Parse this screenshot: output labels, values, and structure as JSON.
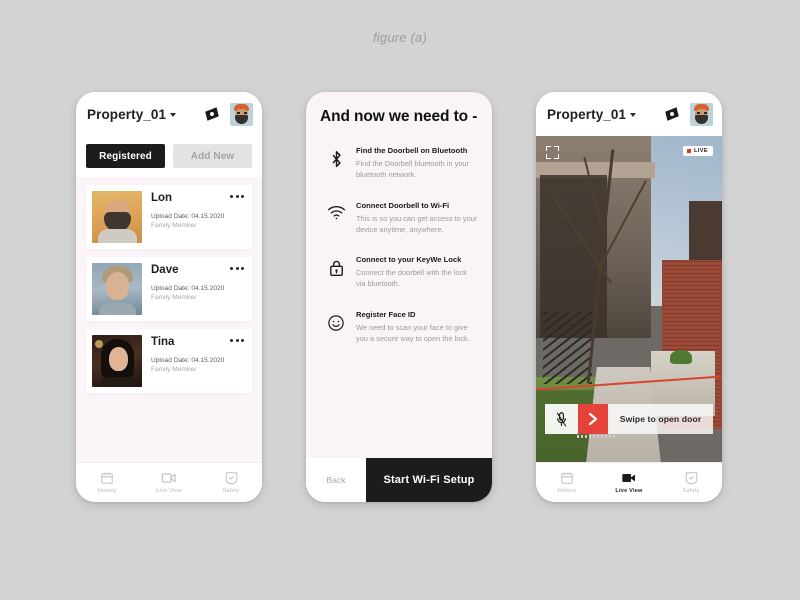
{
  "figure": {
    "caption": "figure (a)"
  },
  "colors": {
    "page_background": "#d3d3d3",
    "screen_background": "#fbf5f9",
    "accent_black": "#1c1c1c",
    "accent_red": "#e5423a",
    "live_dot": "#e0352a",
    "muted_text": "#a8a8a8"
  },
  "screen_registered": {
    "header": {
      "title": "Property_01",
      "dropdown_icon": "chevron-down-icon",
      "sparkle_icon": "sparkle-icon",
      "avatar_icon": "user-avatar"
    },
    "segments": [
      {
        "label": "Registered",
        "active": true
      },
      {
        "label": "Add New",
        "active": false
      }
    ],
    "people": [
      {
        "name": "Lon",
        "upload": "Upload Date: 04.15.2020",
        "role": "Family Member",
        "menu_icon": "more-options-icon"
      },
      {
        "name": "Dave",
        "upload": "Upload Date: 04.15.2020",
        "role": "Family Member",
        "menu_icon": "more-options-icon"
      },
      {
        "name": "Tina",
        "upload": "Upload Date: 04.15.2020",
        "role": "Family Member",
        "menu_icon": "more-options-icon"
      }
    ],
    "tabs": [
      {
        "label": "History",
        "icon": "calendar-icon",
        "active": false
      },
      {
        "label": "Live View",
        "icon": "video-camera-icon",
        "active": false
      },
      {
        "label": "Safety",
        "icon": "shield-check-icon",
        "active": false
      }
    ]
  },
  "screen_setup": {
    "title": "And now we need to -",
    "items": [
      {
        "icon": "bluetooth-icon",
        "title": "Find the Doorbell on Bluetooth",
        "desc": "Find the Doorbell bluetooth in your bluetooth network."
      },
      {
        "icon": "wifi-icon",
        "title": "Connect Doorbell to Wi-Fi",
        "desc": "This is so you can get access to your device anytime, anywhere."
      },
      {
        "icon": "lock-icon",
        "title": "Connect to your KeyWe Lock",
        "desc": "Connect the doorbell with the lock via bluetooth."
      },
      {
        "icon": "smiley-face-icon",
        "title": "Register Face ID",
        "desc": "We need to scan your face to give you a secure way to open the lock."
      }
    ],
    "back_label": "Back",
    "primary_label": "Start Wi-Fi Setup"
  },
  "screen_live": {
    "header": {
      "title": "Property_01",
      "dropdown_icon": "chevron-down-icon",
      "sparkle_icon": "sparkle-icon",
      "avatar_icon": "user-avatar"
    },
    "video": {
      "expand_icon": "fullscreen-expand-icon",
      "live_badge": "LIVE",
      "mic_icon": "microphone-muted-icon",
      "swipe_label": "Swipe to open door",
      "swipe_handle_icon": "chevron-right-icon"
    },
    "tabs": [
      {
        "label": "History",
        "icon": "calendar-icon",
        "active": false
      },
      {
        "label": "Live View",
        "icon": "video-camera-icon",
        "active": true
      },
      {
        "label": "Safety",
        "icon": "shield-check-icon",
        "active": false
      }
    ]
  }
}
